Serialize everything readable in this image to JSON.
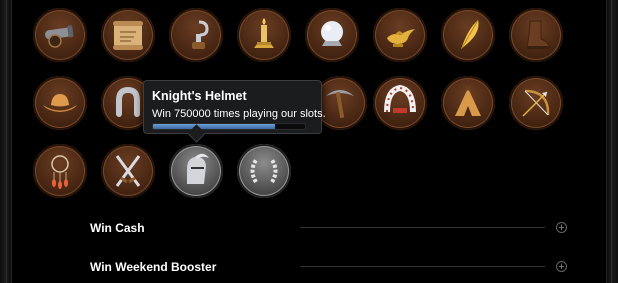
{
  "tooltip": {
    "title": "Knight's Helmet",
    "description": "Win 750000 times playing our slots.",
    "progress": 0.8
  },
  "badges": [
    {
      "icon": "cannon-icon"
    },
    {
      "icon": "scroll-map-icon"
    },
    {
      "icon": "hook-icon"
    },
    {
      "icon": "candle-icon"
    },
    {
      "icon": "crystal-ball-icon"
    },
    {
      "icon": "magic-lamp-icon"
    },
    {
      "icon": "feather-quill-icon"
    },
    {
      "icon": "cowboy-boot-icon"
    },
    {
      "icon": "cowboy-hat-icon"
    },
    {
      "icon": "horseshoe-icon"
    },
    {
      "icon": "pickaxe-icon"
    },
    {
      "icon": "feather-headdress-icon"
    },
    {
      "icon": "teepee-icon"
    },
    {
      "icon": "bow-arrow-icon"
    },
    {
      "icon": "dreamcatcher-icon"
    },
    {
      "icon": "crossed-swords-icon"
    },
    {
      "icon": "knights-helmet-icon"
    },
    {
      "icon": "laurel-wreath-icon"
    }
  ],
  "sections": [
    {
      "label": "Win Cash",
      "icon": "plus-icon"
    },
    {
      "label": "Win Weekend Booster",
      "icon": "plus-icon"
    }
  ]
}
